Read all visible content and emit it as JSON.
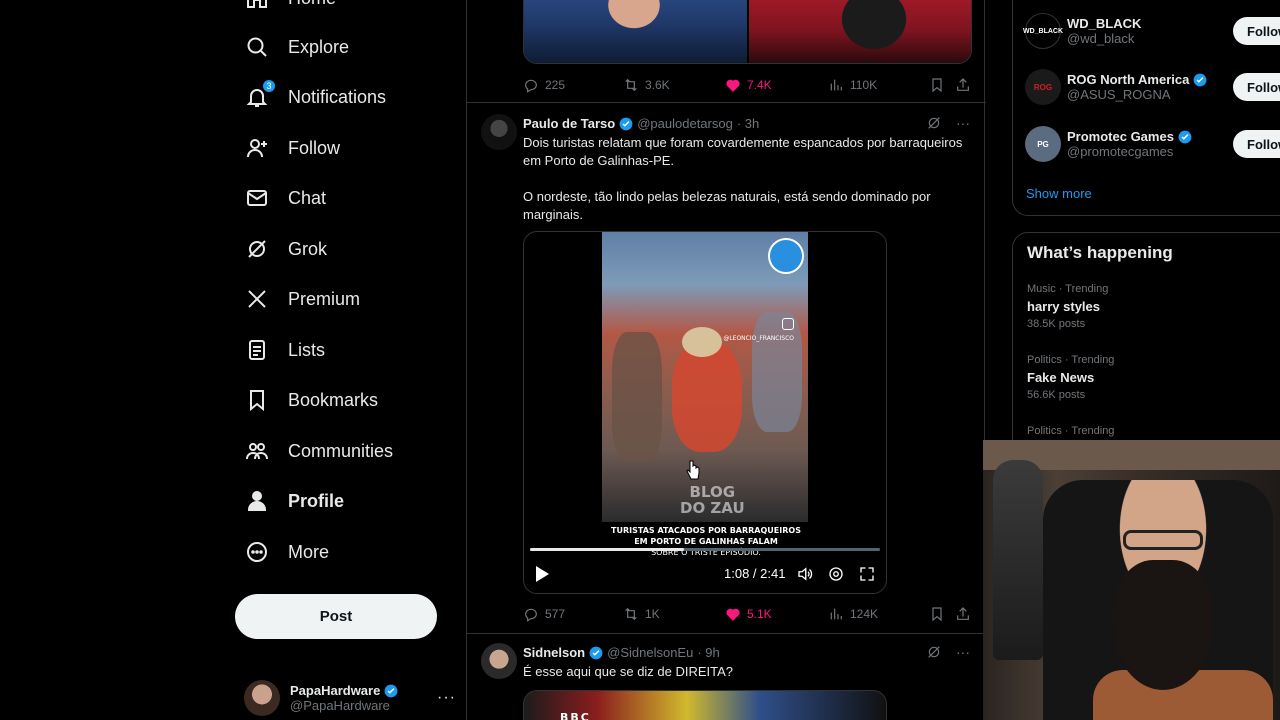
{
  "nav": {
    "items": [
      {
        "label": "Home",
        "icon": "home-icon"
      },
      {
        "label": "Explore",
        "icon": "search-icon"
      },
      {
        "label": "Notifications",
        "icon": "bell-icon",
        "badge": "3"
      },
      {
        "label": "Follow",
        "icon": "person-add-icon"
      },
      {
        "label": "Chat",
        "icon": "envelope-icon"
      },
      {
        "label": "Grok",
        "icon": "grok-icon"
      },
      {
        "label": "Premium",
        "icon": "x-logo-icon"
      },
      {
        "label": "Lists",
        "icon": "list-icon"
      },
      {
        "label": "Bookmarks",
        "icon": "bookmark-icon"
      },
      {
        "label": "Communities",
        "icon": "communities-icon"
      },
      {
        "label": "Profile",
        "icon": "person-icon"
      },
      {
        "label": "More",
        "icon": "more-circle-icon"
      }
    ],
    "post_label": "Post",
    "account": {
      "name": "PapaHardware",
      "handle": "@PapaHardware"
    }
  },
  "feed": {
    "tweet0_actions": {
      "replies": "225",
      "reposts": "3.6K",
      "likes": "7.4K",
      "views": "110K"
    },
    "tweet1": {
      "name": "Paulo de Tarso",
      "handle": "@paulodetarsog",
      "time": "· 3h",
      "text": "Dois turistas relatam que foram covardemente espancados por barraqueiros em Porto de Galinhas-PE.\n\nO nordeste, tão lindo pelas belezas naturais, está sendo dominado por marginais.",
      "video": {
        "caption_line1": "TURISTAS ATACADOS POR BARRAQUEIROS",
        "caption_line2": "EM PORTO DE GALINHAS FALAM",
        "caption_line3": "SOBRE O TRISTE EPISÓDIO.",
        "watermark": "BLOG\nDO ZAU",
        "ig_handle": "@LEONCIO_FRANCISCO",
        "time": "1:08 / 2:41",
        "progress": 0.44
      },
      "actions": {
        "replies": "577",
        "reposts": "1K",
        "likes": "5.1K",
        "views": "124K"
      }
    },
    "tweet2": {
      "name": "Sidnelson",
      "handle": "@SidnelsonEu",
      "time": "· 9h",
      "text": "É esse aqui que se diz de DIREITA?",
      "image_text": "BBC"
    }
  },
  "right": {
    "who_to_follow": [
      {
        "name": "WD_BLACK",
        "handle": "@wd_black",
        "verified": false,
        "avatar_text": "WD_BLACK"
      },
      {
        "name": "ROG North America",
        "handle": "@ASUS_ROGNA",
        "verified": true,
        "avatar_text": "ROG"
      },
      {
        "name": "Promotec Games",
        "handle": "@promotecgames",
        "verified": true,
        "avatar_text": "PG"
      }
    ],
    "follow_label": "Follow",
    "show_more": "Show more",
    "happening_title": "What’s happening",
    "trends": [
      {
        "context": "Music · Trending",
        "title": "harry styles",
        "posts": "38.5K posts"
      },
      {
        "context": "Politics · Trending",
        "title": "Fake News",
        "posts": "56.6K posts"
      },
      {
        "context": "Politics · Trending",
        "title": "",
        "posts": ""
      }
    ]
  },
  "colors": {
    "accent": "#1d9bf0",
    "like": "#f91880",
    "background": "#000000",
    "text": "#e7e9ea",
    "muted": "#71767b",
    "border": "#2f3336"
  }
}
